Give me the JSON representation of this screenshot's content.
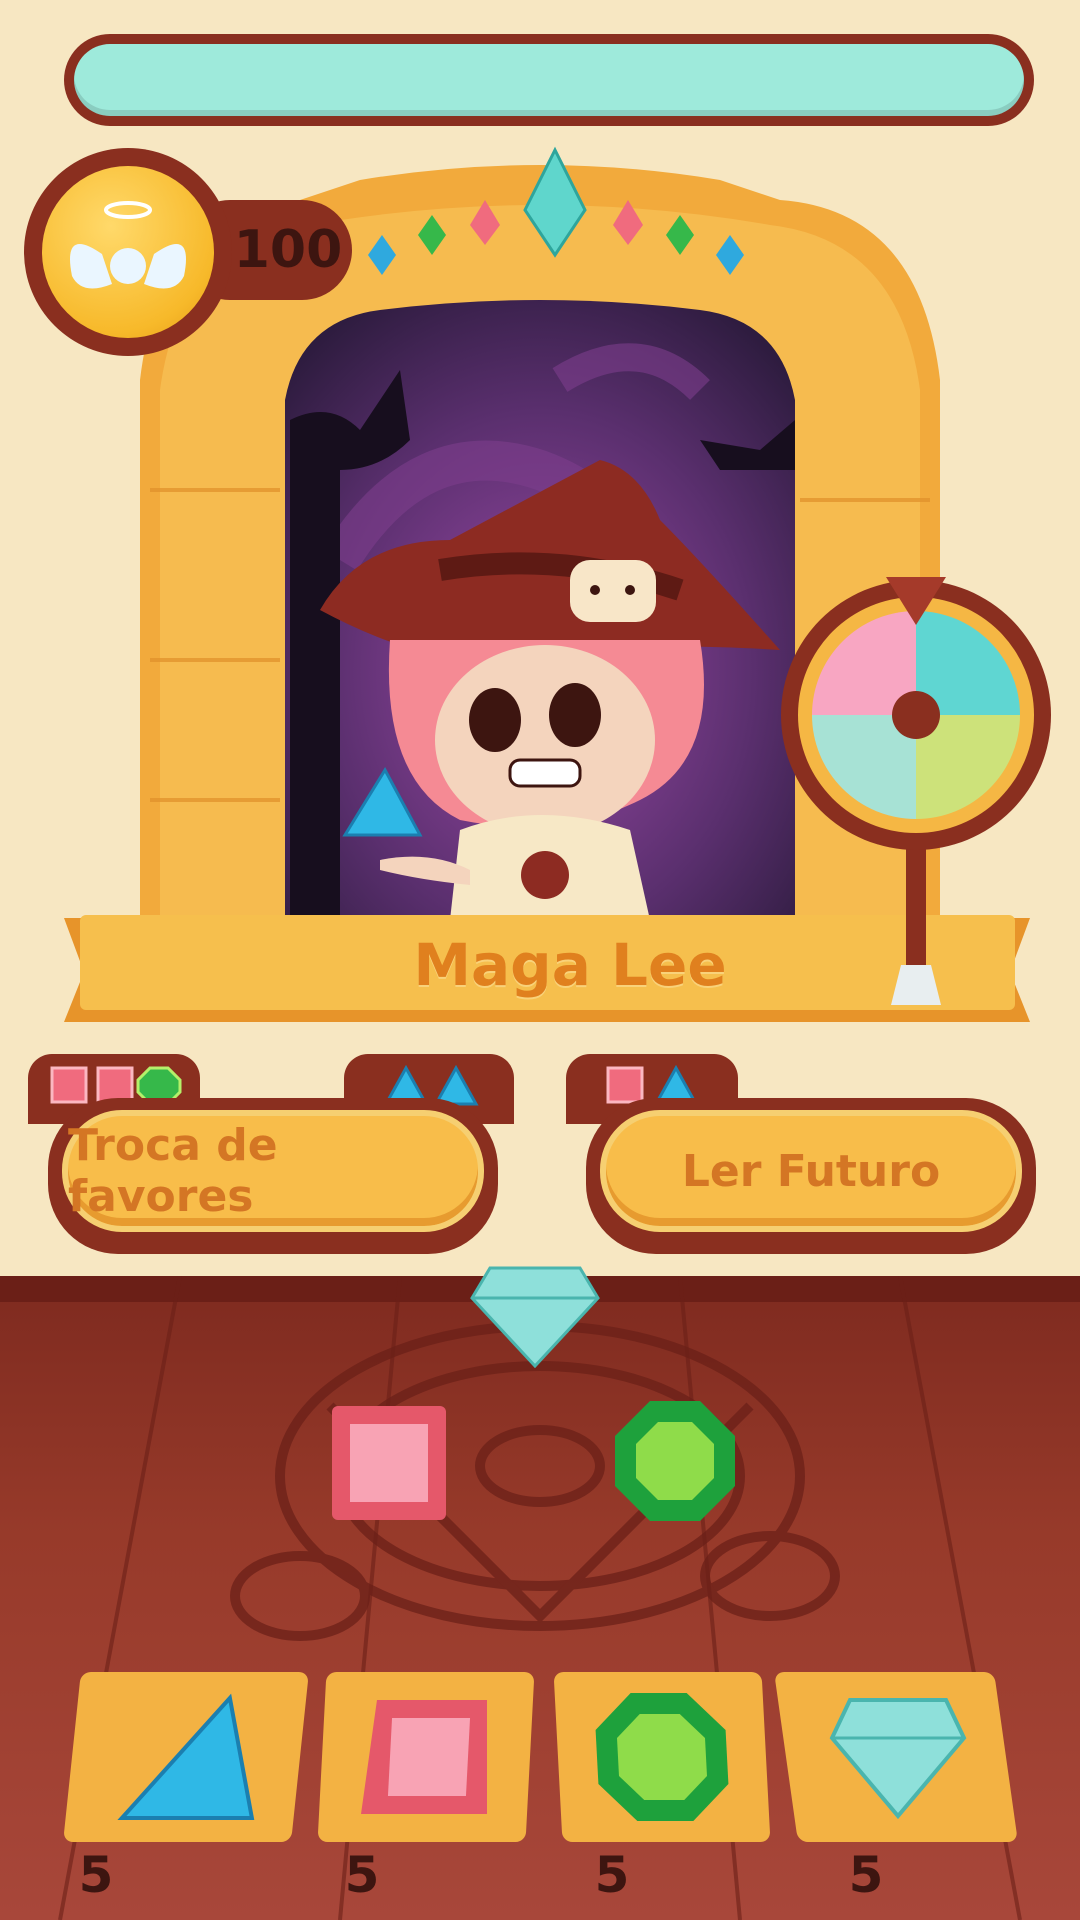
{
  "hud": {
    "currency_icon": "angel-coin-icon",
    "currency_amount": "100"
  },
  "character": {
    "name": "Maga Lee"
  },
  "actions": [
    {
      "label": "Troca de favores",
      "cost_icons": [
        "pink-square-gem-icon",
        "pink-square-gem-icon",
        "green-octagon-gem-icon",
        "blue-triangle-gem-icon",
        "blue-triangle-gem-icon"
      ]
    },
    {
      "label": "Ler Futuro",
      "cost_icons": [
        "pink-square-gem-icon",
        "blue-triangle-gem-icon"
      ]
    }
  ],
  "inventory": [
    {
      "gem": "blue-triangle-gem-icon",
      "count": "5"
    },
    {
      "gem": "pink-square-gem-icon",
      "count": "5"
    },
    {
      "gem": "green-octagon-gem-icon",
      "count": "5"
    },
    {
      "gem": "cyan-diamond-gem-icon",
      "count": "5"
    }
  ],
  "colors": {
    "frame_brown": "#8a2f1f",
    "button_yellow": "#f8bd4a",
    "label_orange": "#d47624",
    "top_bar_mint": "#9eeadb"
  }
}
